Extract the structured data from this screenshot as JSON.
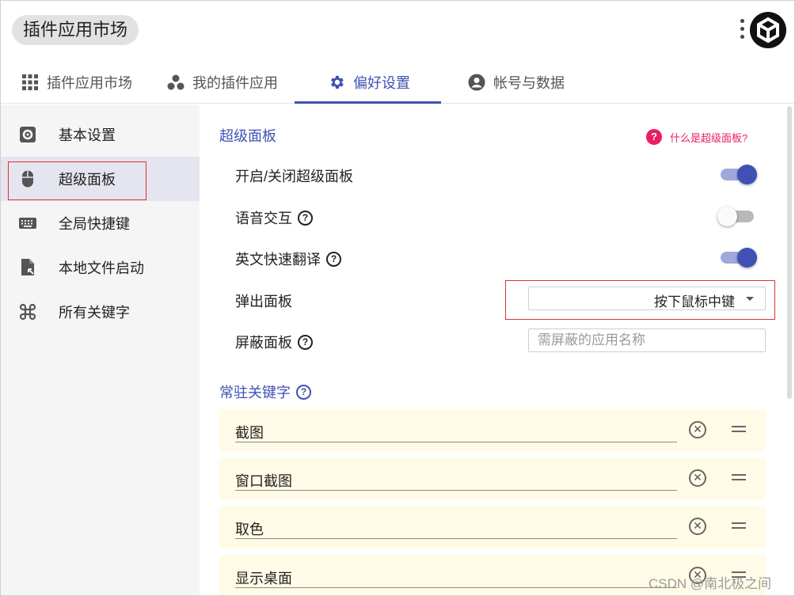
{
  "header": {
    "app_title": "插件应用市场"
  },
  "tabs": [
    {
      "label": "插件应用市场",
      "icon": "grid-icon"
    },
    {
      "label": "我的插件应用",
      "icon": "plugins-icon"
    },
    {
      "label": "偏好设置",
      "icon": "gear-icon",
      "active": true
    },
    {
      "label": "帐号与数据",
      "icon": "account-icon"
    }
  ],
  "sidebar": {
    "items": [
      {
        "label": "基本设置",
        "icon": "settings-box-icon"
      },
      {
        "label": "超级面板",
        "icon": "mouse-icon",
        "active": true
      },
      {
        "label": "全局快捷键",
        "icon": "keyboard-icon"
      },
      {
        "label": "本地文件启动",
        "icon": "file-launch-icon"
      },
      {
        "label": "所有关键字",
        "icon": "command-icon"
      }
    ]
  },
  "main": {
    "section_title": "超级面板",
    "help_link": "什么是超级面板?",
    "rows": {
      "toggle_panel": {
        "label": "开启/关闭超级面板",
        "enabled": true
      },
      "voice": {
        "label": "语音交互",
        "enabled": false
      },
      "translate": {
        "label": "英文快速翻译",
        "enabled": true
      },
      "popup": {
        "label": "弹出面板",
        "value": "按下鼠标中键"
      },
      "block": {
        "label": "屏蔽面板",
        "placeholder": "需屏蔽的应用名称"
      }
    },
    "keywords_title": "常驻关键字",
    "keywords": [
      "截图",
      "窗口截图",
      "取色",
      "显示桌面"
    ]
  },
  "watermark": "CSDN @南北极之间",
  "colors": {
    "accent": "#3f51b5",
    "help_pink": "#e91e63",
    "keyword_bg": "#fffbe6",
    "highlight_red": "#dd3333"
  }
}
